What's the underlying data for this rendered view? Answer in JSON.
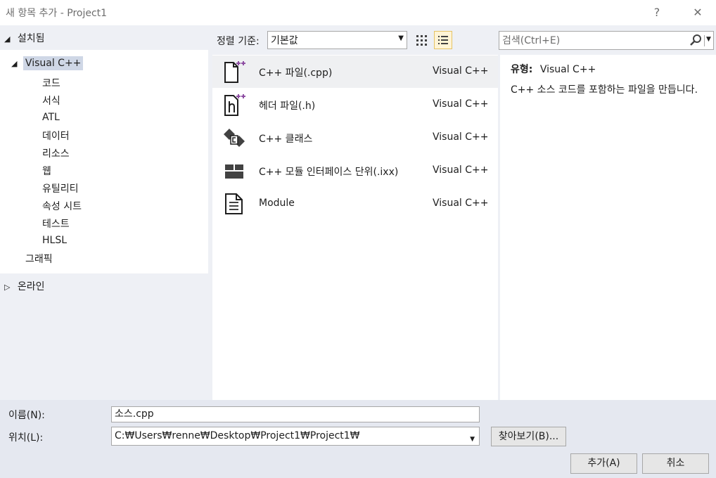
{
  "window": {
    "title": "새 항목 추가 - Project1",
    "help_glyph": "?",
    "close_glyph": "✕"
  },
  "toolbar": {
    "sort_label": "정렬 기준:",
    "sort_value": "기본값",
    "search_placeholder": "검색(Ctrl+E)"
  },
  "tree": {
    "installed": "설치됨",
    "visual_cpp": "Visual C++",
    "children": [
      "코드",
      "서식",
      "ATL",
      "데이터",
      "리소스",
      "웹",
      "유틸리티",
      "속성 시트",
      "테스트",
      "HLSL"
    ],
    "graphics": "그래픽",
    "online": "온라인"
  },
  "templates": [
    {
      "name": "C++ 파일(.cpp)",
      "type": "Visual C++",
      "icon": "cpp-file-icon"
    },
    {
      "name": "헤더 파일(.h)",
      "type": "Visual C++",
      "icon": "header-file-icon"
    },
    {
      "name": "C++ 클래스",
      "type": "Visual C++",
      "icon": "class-icon"
    },
    {
      "name": "C++ 모듈 인터페이스 단위(.ixx)",
      "type": "Visual C++",
      "icon": "module-interface-icon"
    },
    {
      "name": "Module",
      "type": "Visual C++",
      "icon": "module-doc-icon"
    }
  ],
  "details": {
    "type_label": "유형:",
    "type_value": "Visual C++",
    "description": "C++ 소스 코드를 포함하는 파일을 만듭니다."
  },
  "form": {
    "name_label": "이름(N):",
    "name_value": "소스.cpp",
    "location_label": "위치(L):",
    "location_value": "C:₩Users₩renne₩Desktop₩Project1₩Project1₩",
    "browse_label": "찾아보기(B)...",
    "add_label": "추가(A)",
    "cancel_label": "취소"
  },
  "colors": {
    "accent_purple": "#8e4fa3",
    "selection": "#cfd7e6",
    "list_view_active": "#fff4d6"
  }
}
